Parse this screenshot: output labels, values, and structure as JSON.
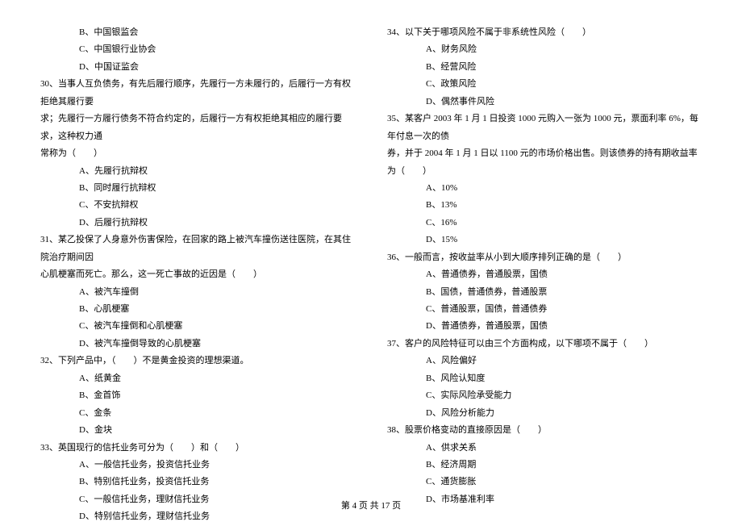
{
  "left_column": {
    "q29_options_tail": [
      "B、中国银监会",
      "C、中国银行业协会",
      "D、中国证监会"
    ],
    "q30": {
      "stem_l1": "30、当事人互负债务，有先后履行顺序，先履行一方未履行的，后履行一方有权拒绝其履行要",
      "stem_l2": "求；先履行一方履行债务不符合约定的，后履行一方有权拒绝其相应的履行要求，这种权力通",
      "stem_l3": "常称为（　　）",
      "options": [
        "A、先履行抗辩权",
        "B、同时履行抗辩权",
        "C、不安抗辩权",
        "D、后履行抗辩权"
      ]
    },
    "q31": {
      "stem_l1": "31、某乙投保了人身意外伤害保险，在回家的路上被汽车撞伤送往医院，在其住院治疗期间因",
      "stem_l2": "心肌梗塞而死亡。那么，这一死亡事故的近因是（　　）",
      "options": [
        "A、被汽车撞倒",
        "B、心肌梗塞",
        "C、被汽车撞倒和心肌梗塞",
        "D、被汽车撞倒导致的心肌梗塞"
      ]
    },
    "q32": {
      "stem_l1": "32、下列产品中，（　　）不是黄金投资的理想渠道。",
      "options": [
        "A、纸黄金",
        "B、金首饰",
        "C、金条",
        "D、金块"
      ]
    },
    "q33": {
      "stem_l1": "33、英国现行的信托业务可分为（　　）和（　　）",
      "options": [
        "A、一般信托业务，投资信托业务",
        "B、特别信托业务，投资信托业务",
        "C、一般信托业务，理财信托业务",
        "D、特别信托业务，理财信托业务"
      ]
    }
  },
  "right_column": {
    "q34": {
      "stem_l1": "34、以下关于哪项风险不属于非系统性风险（　　）",
      "options": [
        "A、财务风险",
        "B、经营风险",
        "C、政策风险",
        "D、偶然事件风险"
      ]
    },
    "q35": {
      "stem_l1": "35、某客户 2003 年 1 月 1 日投资 1000 元购入一张为 1000 元，票面利率 6%，每年付息一次的债",
      "stem_l2": "券，并于 2004 年 1 月 1 日以 1100 元的市场价格出售。则该债券的持有期收益率为（　　）",
      "options": [
        "A、10%",
        "B、13%",
        "C、16%",
        "D、15%"
      ]
    },
    "q36": {
      "stem_l1": "36、一般而言，按收益率从小到大顺序排列正确的是（　　）",
      "options": [
        "A、普通债券，普通股票，国债",
        "B、国债，普通债券，普通股票",
        "C、普通股票，国债，普通债券",
        "D、普通债券，普通股票，国债"
      ]
    },
    "q37": {
      "stem_l1": "37、客户的风险特征可以由三个方面构成，以下哪项不属于（　　）",
      "options": [
        "A、风险偏好",
        "B、风险认知度",
        "C、实际风险承受能力",
        "D、风险分析能力"
      ]
    },
    "q38": {
      "stem_l1": "38、股票价格变动的直接原因是（　　）",
      "options": [
        "A、供求关系",
        "B、经济周期",
        "C、通货膨胀",
        "D、市场基准利率"
      ]
    }
  },
  "footer": "第 4 页  共 17 页"
}
